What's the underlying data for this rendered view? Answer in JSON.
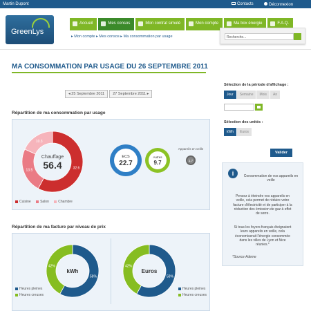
{
  "topbar": {
    "user": "Martin Dupont",
    "contacts": "Contacts",
    "logout": "Déconnexion"
  },
  "logo": {
    "text": "GreenLys"
  },
  "nav": [
    {
      "label": "Accueil",
      "icon": "home-icon",
      "active": false
    },
    {
      "label": "Mes consos",
      "icon": "bar-chart-icon",
      "active": true
    },
    {
      "label": "Mon contrat simulé",
      "icon": "document-icon",
      "active": false
    },
    {
      "label": "Mon compte",
      "icon": "user-icon",
      "active": false
    },
    {
      "label": "Ma box énergie",
      "icon": "box-icon",
      "active": false
    },
    {
      "label": "F.A.Q.",
      "icon": "question-icon",
      "active": false
    }
  ],
  "search": {
    "placeholder": "Recherche..."
  },
  "breadcrumb": {
    "a": "Mon compte",
    "b": "Mes consos",
    "c": "Ma consommation par usage"
  },
  "page": {
    "title": "MA CONSOMMATION PAR USAGE",
    "title_date": "DU 26 SEPTEMBRE 2011"
  },
  "datenav": {
    "prev": "25 Septembre 2011",
    "next": "27 Septembre 2011"
  },
  "usage": {
    "heading": "Répartition de ma consommation par usage",
    "center_label": "Chauffage",
    "center_value": "56.4",
    "ecs": {
      "label": "ECS",
      "value": "22.7"
    },
    "autres": {
      "label": "Autres",
      "value": "9.7"
    },
    "veille": {
      "label": "Appareils en veille",
      "value": "1.7"
    },
    "legend": [
      "Cuisine",
      "Salon",
      "Chambre"
    ]
  },
  "chart_data": [
    {
      "type": "pie",
      "title": "Chauffage",
      "categories": [
        "Cuisine",
        "Salon",
        "Chambre"
      ],
      "values": [
        32.6,
        13.5,
        10.3
      ],
      "colors": [
        "#cc2e2e",
        "#ea7b85",
        "#f6b4bb"
      ]
    },
    {
      "type": "pie",
      "title": "kWh",
      "categories": [
        "Heures pleines",
        "Heures creuses"
      ],
      "values": [
        58,
        42
      ],
      "colors": [
        "#1f5a8c",
        "#86bd21"
      ]
    },
    {
      "type": "pie",
      "title": "Euros",
      "categories": [
        "Heures pleines",
        "Heures creuses"
      ],
      "values": [
        58,
        42
      ],
      "colors": [
        "#1f5a8c",
        "#86bd21"
      ]
    }
  ],
  "facture": {
    "heading": "Répartition de ma facture par niveau de prix",
    "legend": [
      "Heures pleines",
      "Heures creuses"
    ],
    "kwh_label": "kWh",
    "euros_label": "Euros"
  },
  "sidebar": {
    "period_label": "Sélection de la période d'affichage :",
    "periods": [
      "Jour",
      "Semaine",
      "Mois",
      "An"
    ],
    "units_label": "Sélection des unités :",
    "units": [
      "kWh",
      "Euros"
    ],
    "validate": "Valider",
    "info_title": "Consommation de vos appareils en veille",
    "info_p1": "Pensez à éteindre vos appareils en veille, cela permet de réduire votre facture d'électricité et de participer à la réduction des émission de gaz à effet de serre.",
    "info_p2": "Si tous les foyers français éteignaient leurs appareils en veille, cela économiserait l'énergie consommée dans les villes de Lyon et Nice réunies.*",
    "info_src": "*Source Ademe"
  }
}
